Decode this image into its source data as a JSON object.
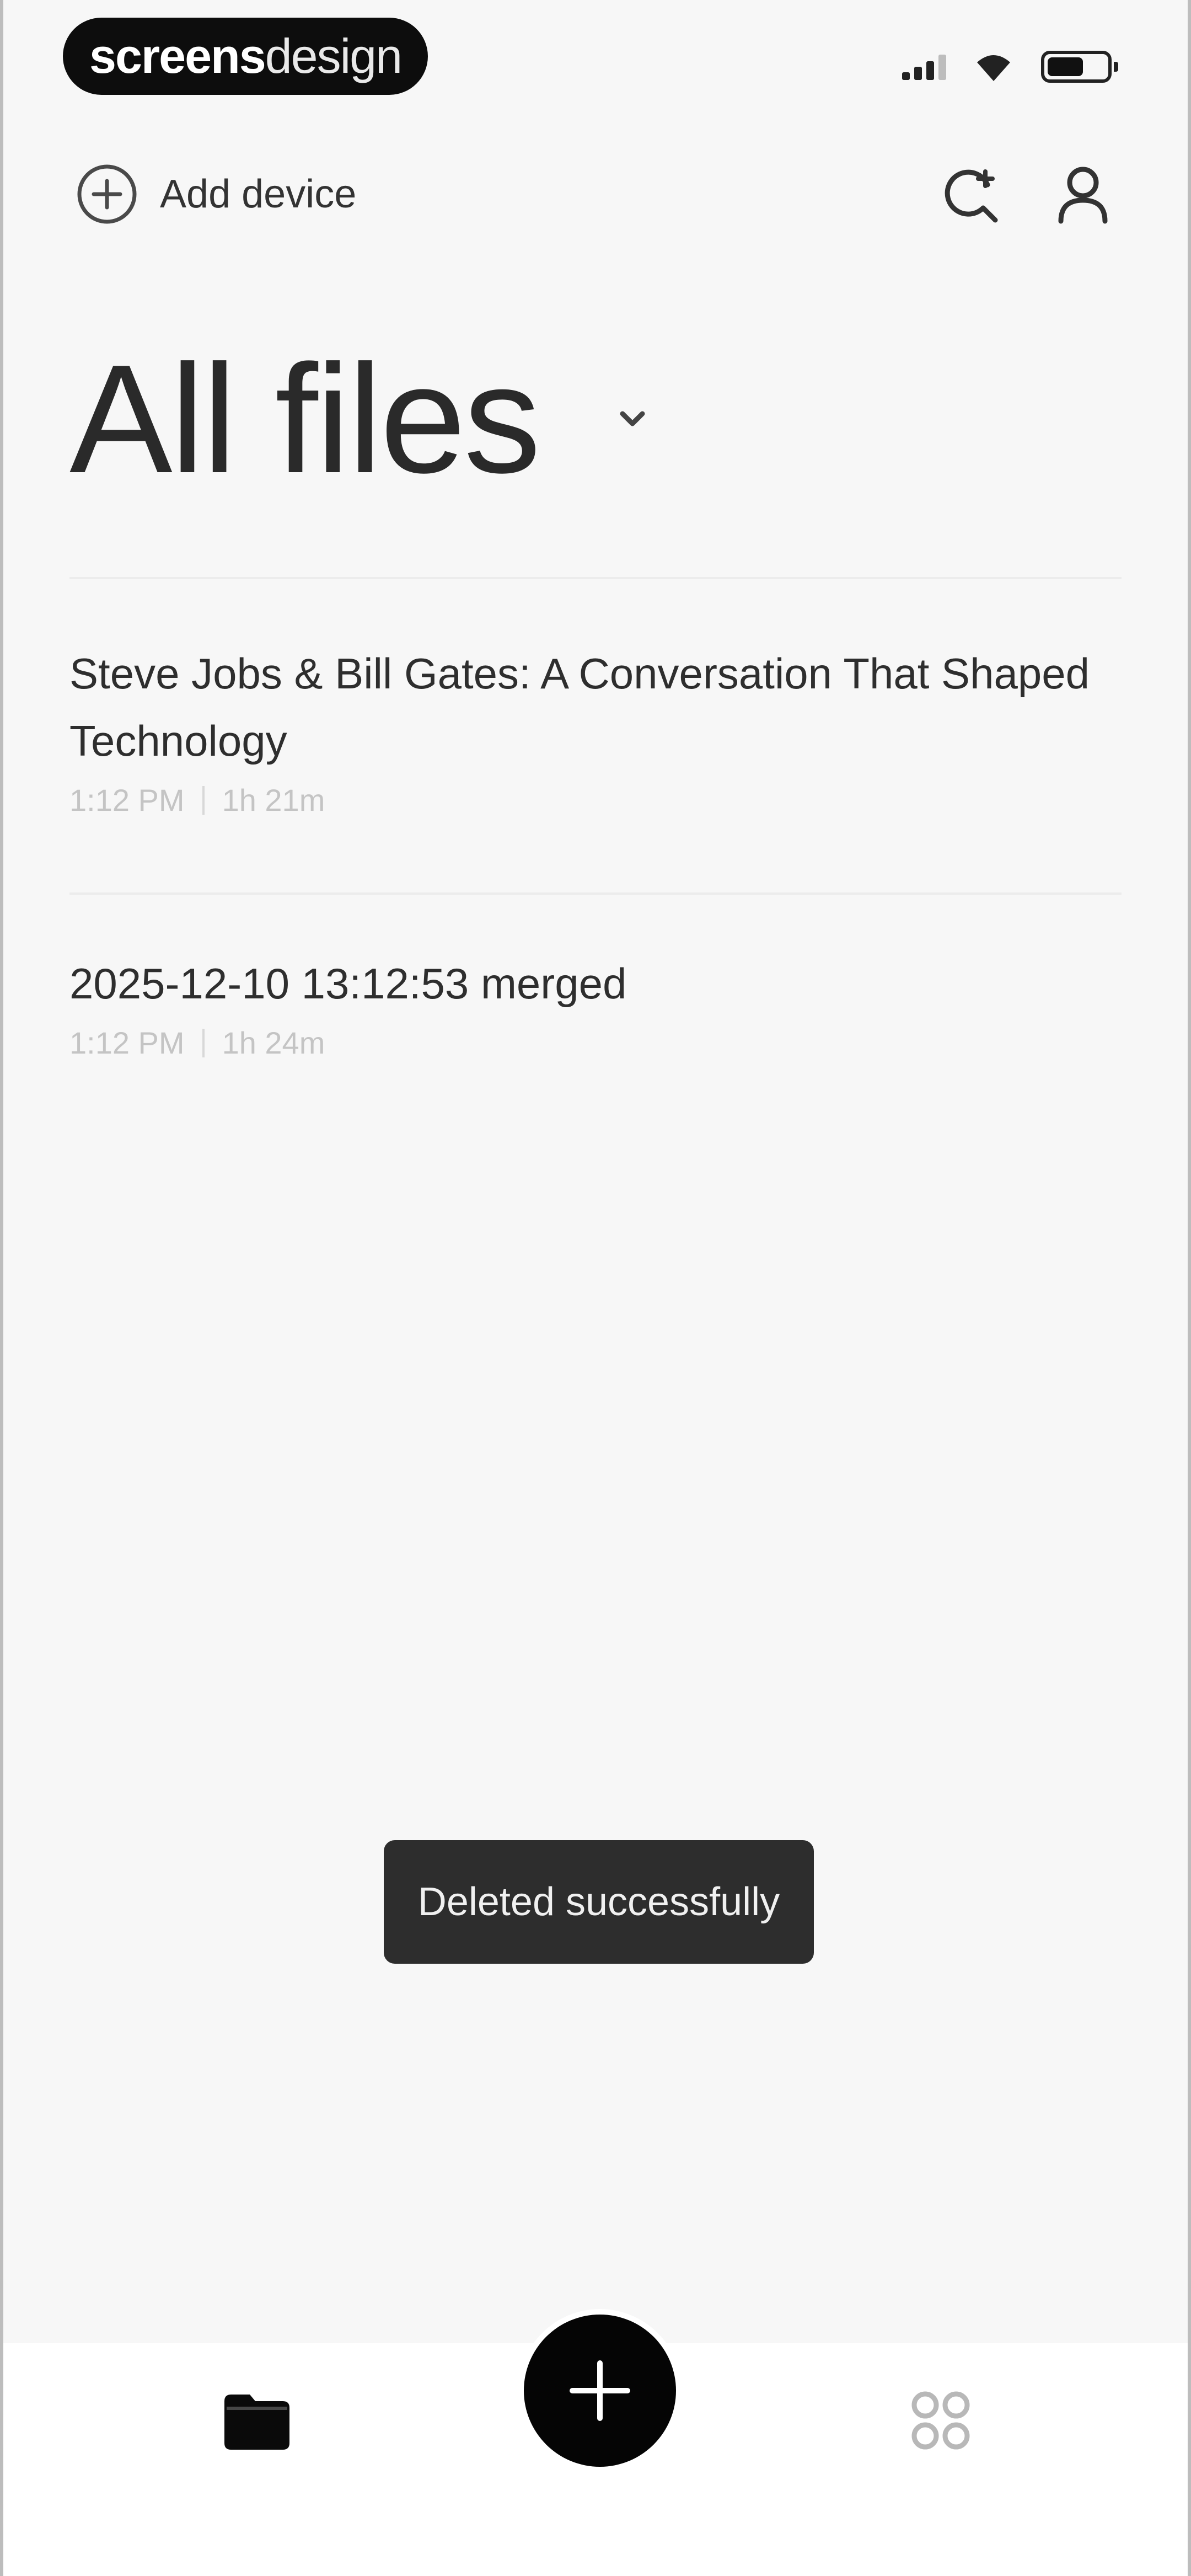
{
  "status_bar": {
    "brand_part1": "screens",
    "brand_part2": "design"
  },
  "top_nav": {
    "add_device_label": "Add device"
  },
  "page": {
    "title": "All files"
  },
  "files": [
    {
      "title": "Steve Jobs & Bill Gates: A Conversation That Shaped Technology",
      "time": "1:12 PM",
      "duration": "1h 21m"
    },
    {
      "title": "2025-12-10 13:12:53 merged",
      "time": "1:12 PM",
      "duration": "1h 24m"
    }
  ],
  "toast": {
    "message": "Deleted successfully"
  },
  "icons": {
    "add_device": "plus-circle-icon",
    "search": "search-icon",
    "profile": "user-icon",
    "title_dropdown": "chevron-down-icon",
    "files_tab": "folder-icon",
    "fab": "plus-icon",
    "apps_tab": "apps-grid-icon"
  },
  "colors": {
    "background": "#f7f7f7",
    "toast_background": "#2d2d2d",
    "fab_background": "#050505",
    "meta_text": "#c4c4c4"
  }
}
